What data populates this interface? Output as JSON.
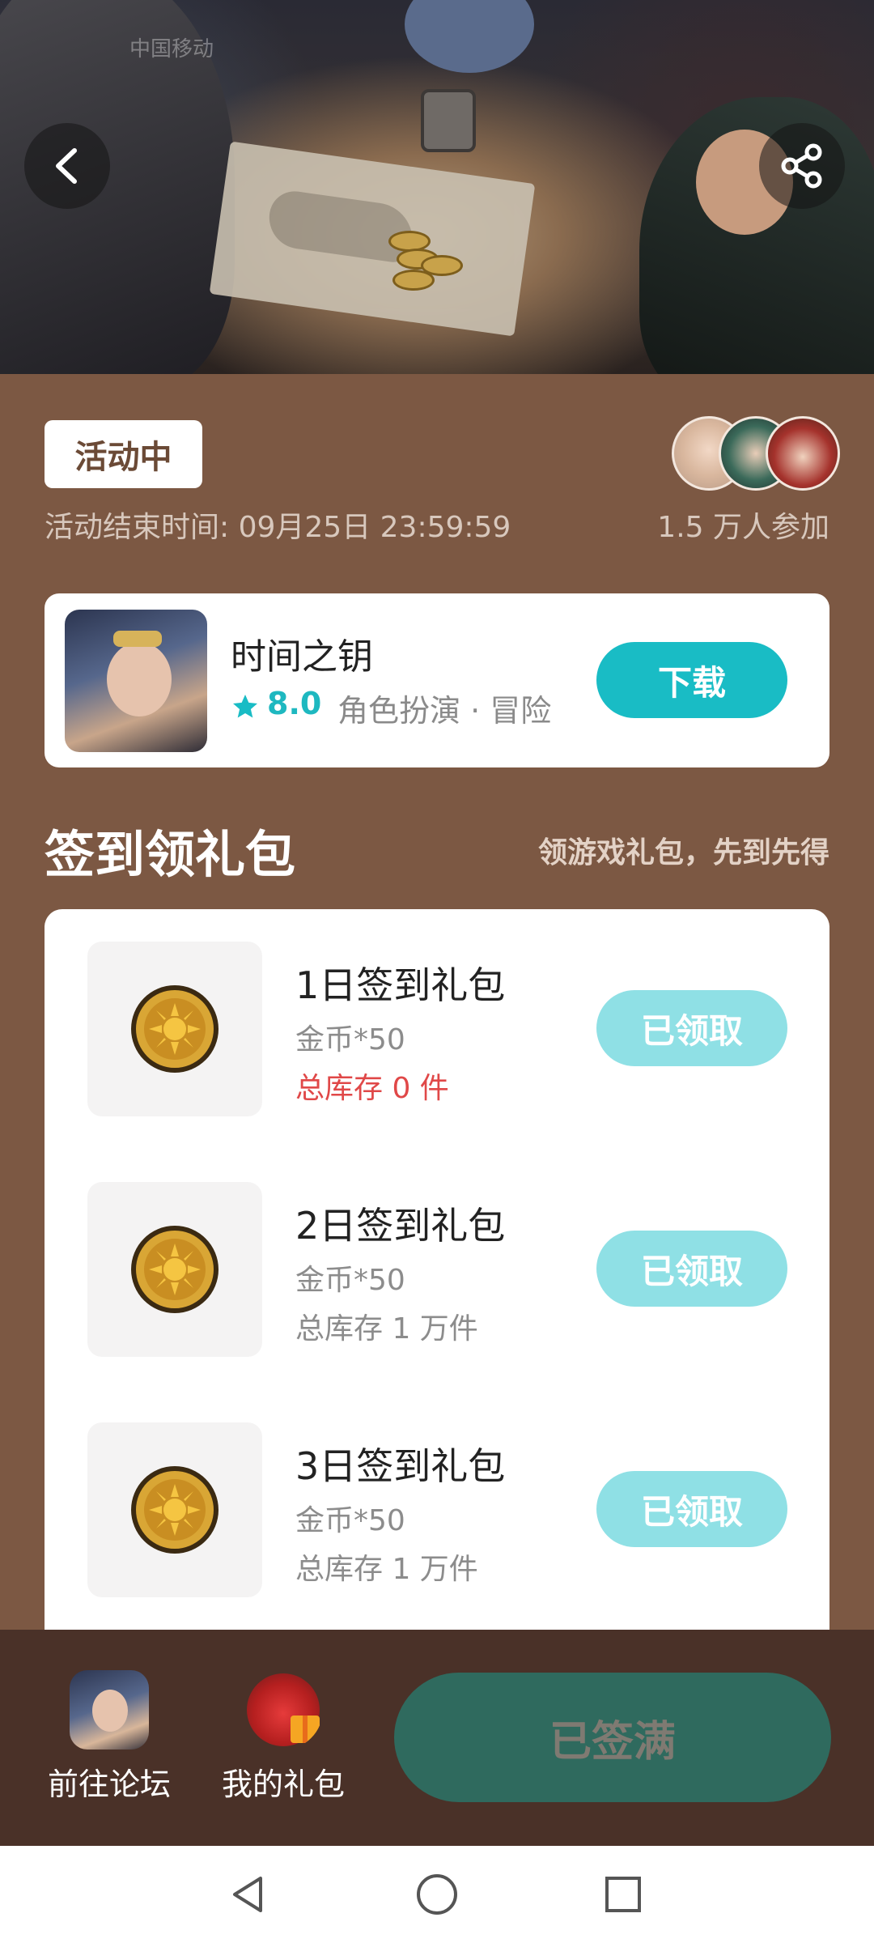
{
  "status_bar": {
    "faded_text": "中国移动"
  },
  "activity": {
    "status_badge": "活动中",
    "end_time": "活动结束时间: 09月25日 23:59:59",
    "participants": "1.5 万人参加"
  },
  "game": {
    "name": "时间之钥",
    "rating": "8.0",
    "genre": "角色扮演 · 冒险",
    "download_label": "下载"
  },
  "section": {
    "title": "签到领礼包",
    "subtitle": "领游戏礼包，先到先得"
  },
  "gifts": [
    {
      "title": "1日签到礼包",
      "reward": "金币*50",
      "stock": "总库存 0 件",
      "button": "已领取"
    },
    {
      "title": "2日签到礼包",
      "reward": "金币*50",
      "stock": "总库存 1 万件",
      "button": "已领取"
    },
    {
      "title": "3日签到礼包",
      "reward": "金币*50",
      "stock": "总库存 1 万件",
      "button": "已领取"
    }
  ],
  "bottom_bar": {
    "forum_label": "前往论坛",
    "my_gifts_label": "我的礼包",
    "signin_button": "已签满"
  },
  "icons": {
    "back": "back-arrow-icon",
    "share": "share-icon",
    "star": "star-icon",
    "coin": "gold-coin-icon",
    "nav_back": "triangle-back-icon",
    "nav_home": "circle-home-icon",
    "nav_recent": "square-recent-icon"
  },
  "colors": {
    "background": "#7c5843",
    "accent": "#19bcc5",
    "claimed": "#8fe0e5",
    "out_of_stock": "#e04848",
    "bottom_bar": "#4a3128",
    "full_button": "#2f6a5e"
  }
}
